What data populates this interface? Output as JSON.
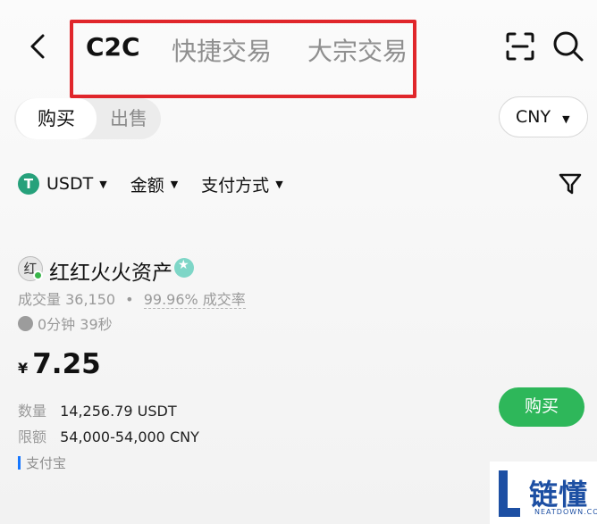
{
  "header": {
    "tabs": [
      {
        "label": "C2C"
      },
      {
        "label": "快捷交易"
      },
      {
        "label": "大宗交易"
      }
    ]
  },
  "trade_toggle": {
    "buy": "购买",
    "sell": "出售"
  },
  "currency": {
    "selected": "CNY"
  },
  "filters": [
    {
      "label": "USDT",
      "icon": "tether-icon"
    },
    {
      "label": "金额"
    },
    {
      "label": "支付方式"
    }
  ],
  "offer": {
    "merchant": "红红火火资产",
    "avatar_char": "红",
    "trades": "成交量 36,150",
    "separator": "•",
    "completion": "99.96% 成交率",
    "time": "0分钟 39秒",
    "currency_symbol": "¥",
    "price": "7.25",
    "quantity_label": "数量",
    "quantity": "14,256.79 USDT",
    "limit_label": "限额",
    "limit": "54,000-54,000 CNY",
    "payment": "支付宝",
    "buy_label": "购买"
  },
  "watermark": {
    "text": "链懂",
    "sub": "NEATDOWN.COM"
  },
  "colors": {
    "buy_green": "#2eb75a",
    "highlight_red": "#e0262b",
    "tether_green": "#26a17b"
  }
}
